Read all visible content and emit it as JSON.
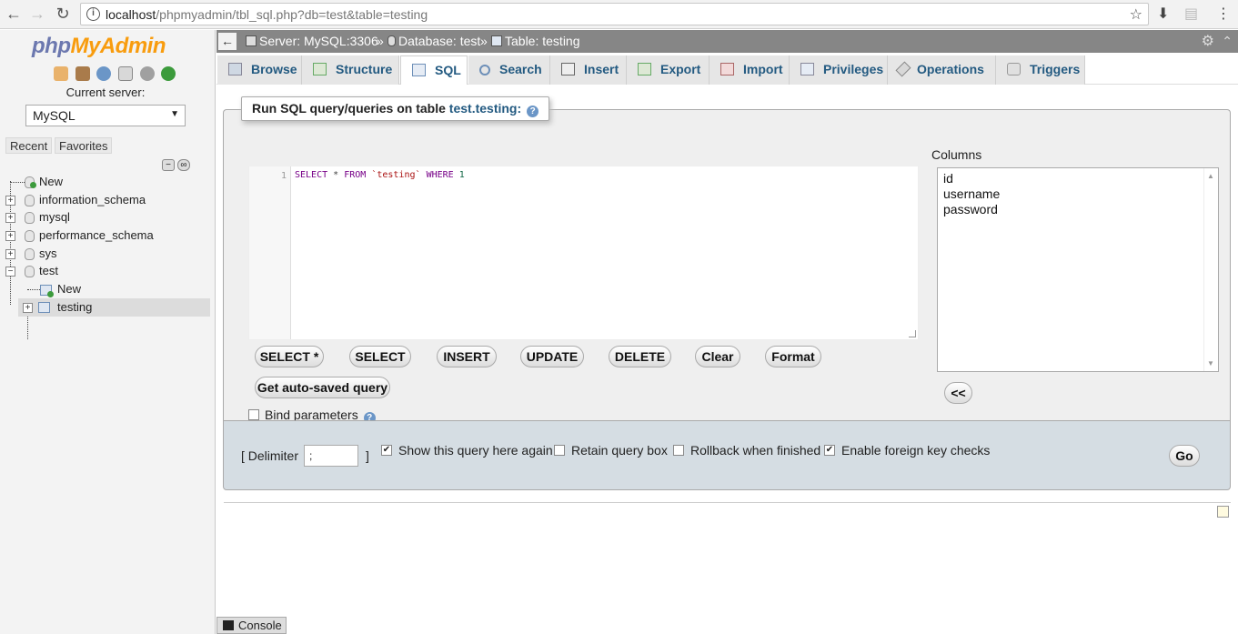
{
  "browser": {
    "url_host": "localhost",
    "url_path": "/phpmyadmin/tbl_sql.php?db=test&table=testing"
  },
  "sidebar": {
    "logo_php": "php",
    "logo_myadmin": "MyAdmin",
    "current_server_label": "Current server:",
    "server_value": "MySQL",
    "recent_label": "Recent",
    "favorites_label": "Favorites",
    "tree": {
      "new_root": "New",
      "databases": [
        "information_schema",
        "mysql",
        "performance_schema",
        "sys",
        "test"
      ],
      "test_children": {
        "new": "New",
        "table": "testing"
      }
    }
  },
  "breadcrumb": {
    "server": "Server: MySQL:3306",
    "database": "Database: test",
    "table": "Table: testing",
    "sep": "»"
  },
  "tabs": [
    "Browse",
    "Structure",
    "SQL",
    "Search",
    "Insert",
    "Export",
    "Import",
    "Privileges",
    "Operations",
    "Triggers"
  ],
  "active_tab": "SQL",
  "sql_panel": {
    "legend_prefix": "Run SQL query/queries on table",
    "legend_table": "test.testing:",
    "line_number": "1",
    "query": {
      "select": "SELECT",
      "star": "*",
      "from": "FROM",
      "table": "`testing`",
      "where": "WHERE",
      "value": "1"
    },
    "buttons": {
      "select_star": "SELECT *",
      "select": "SELECT",
      "insert": "INSERT",
      "update": "UPDATE",
      "delete": "DELETE",
      "clear": "Clear",
      "format": "Format",
      "auto_saved": "Get auto-saved query",
      "insert_cols": "<<"
    },
    "bind_parameters_label": "Bind parameters",
    "bind_parameters_checked": false,
    "columns_label": "Columns",
    "columns": [
      "id",
      "username",
      "password"
    ]
  },
  "options": {
    "delimiter_label_open": "[ Delimiter",
    "delimiter_value": ";",
    "delimiter_label_close": "]",
    "show_query_label": "Show this query here again",
    "show_query_checked": true,
    "retain_label": "Retain query box",
    "retain_checked": false,
    "rollback_label": "Rollback when finished",
    "rollback_checked": false,
    "fk_label": "Enable foreign key checks",
    "fk_checked": true,
    "go_label": "Go"
  },
  "console_label": "Console",
  "colors": {
    "link_blue": "#235a81",
    "breadcrumb_bg": "#868686",
    "options_bg": "#d5dde3"
  }
}
